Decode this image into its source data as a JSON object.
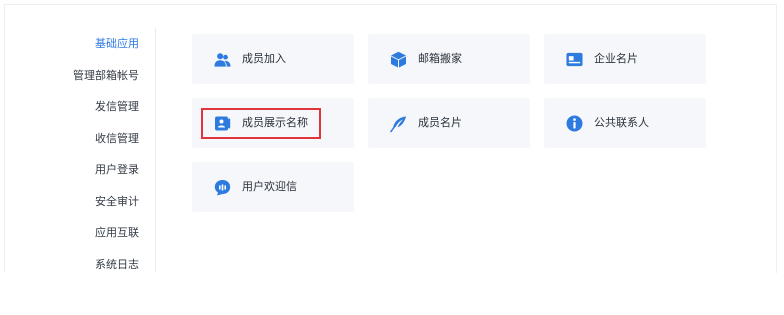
{
  "sidebar": {
    "items": [
      {
        "label": "基础应用",
        "active": true
      },
      {
        "label": "管理部箱帐号"
      },
      {
        "label": "发信管理"
      },
      {
        "label": "收信管理"
      },
      {
        "label": "用户登录"
      },
      {
        "label": "安全审计"
      },
      {
        "label": "应用互联"
      },
      {
        "label": "系统日志"
      }
    ]
  },
  "cards": [
    {
      "label": "成员加入",
      "icon": "users-add-icon"
    },
    {
      "label": "邮箱搬家",
      "icon": "box-icon"
    },
    {
      "label": "企业名片",
      "icon": "business-card-icon"
    },
    {
      "label": "成员展示名称",
      "icon": "id-badge-icon"
    },
    {
      "label": "成员名片",
      "icon": "feather-icon"
    },
    {
      "label": "公共联系人",
      "icon": "info-icon"
    },
    {
      "label": "用户欢迎信",
      "icon": "chat-bubble-icon"
    }
  ],
  "colors": {
    "accent": "#2e7be0",
    "card_bg": "#f5f7fa",
    "highlight": "#e0353a"
  }
}
